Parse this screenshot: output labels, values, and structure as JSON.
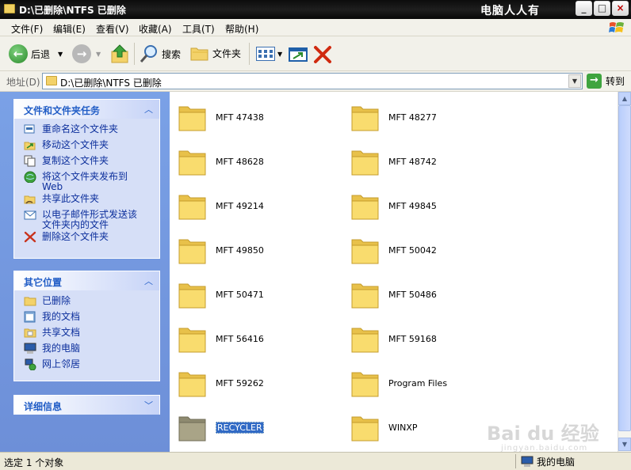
{
  "window": {
    "title": "D:\\已删除\\NTFS 已删除",
    "watermark": "电脑人人有"
  },
  "menu": [
    "文件(F)",
    "编辑(E)",
    "查看(V)",
    "收藏(A)",
    "工具(T)",
    "帮助(H)"
  ],
  "toolbar": {
    "back_label": "后退",
    "search_label": "搜索",
    "folders_label": "文件夹"
  },
  "address": {
    "label": "地址(D)",
    "value": "D:\\已删除\\NTFS 已删除",
    "go_label": "转到"
  },
  "tasks_panel": {
    "title": "文件和文件夹任务",
    "items": [
      {
        "label": "重命名这个文件夹",
        "icon": "rename-icon"
      },
      {
        "label": "移动这个文件夹",
        "icon": "move-icon"
      },
      {
        "label": "复制这个文件夹",
        "icon": "copy-icon"
      },
      {
        "label": "将这个文件夹发布到",
        "label2": "Web",
        "icon": "publish-web-icon"
      },
      {
        "label": "共享此文件夹",
        "icon": "share-icon"
      },
      {
        "label": "以电子邮件形式发送该",
        "label2": "文件夹内的文件",
        "icon": "email-icon"
      },
      {
        "label": "删除这个文件夹",
        "icon": "delete-icon"
      }
    ]
  },
  "places_panel": {
    "title": "其它位置",
    "items": [
      {
        "label": "已删除",
        "icon": "folder-icon"
      },
      {
        "label": "我的文档",
        "icon": "my-documents-icon"
      },
      {
        "label": "共享文档",
        "icon": "shared-documents-icon"
      },
      {
        "label": "我的电脑",
        "icon": "my-computer-icon"
      },
      {
        "label": "网上邻居",
        "icon": "network-icon"
      }
    ]
  },
  "details_panel": {
    "title": "详细信息"
  },
  "folders": [
    {
      "name": "MFT 47438"
    },
    {
      "name": "MFT 48277"
    },
    {
      "name": "MFT 48628"
    },
    {
      "name": "MFT 48742"
    },
    {
      "name": "MFT 49214"
    },
    {
      "name": "MFT 49845"
    },
    {
      "name": "MFT 49850"
    },
    {
      "name": "MFT 50042"
    },
    {
      "name": "MFT 50471"
    },
    {
      "name": "MFT 50486"
    },
    {
      "name": "MFT 56416"
    },
    {
      "name": "MFT 59168"
    },
    {
      "name": "MFT 59262"
    },
    {
      "name": "Program Files"
    },
    {
      "name": "RECYCLER",
      "selected": true
    },
    {
      "name": "WINXP"
    }
  ],
  "watermark_bottom": {
    "main": "Bai du 经验",
    "sub": "jingyan.baidu.com"
  },
  "status": {
    "left": "选定 1 个对象",
    "right": "我的电脑"
  },
  "colors": {
    "taskpane_bg": "#7aa1e6",
    "panel_title": "#215dc6",
    "link_text": "#0c2f9c",
    "selection": "#316ac5"
  }
}
